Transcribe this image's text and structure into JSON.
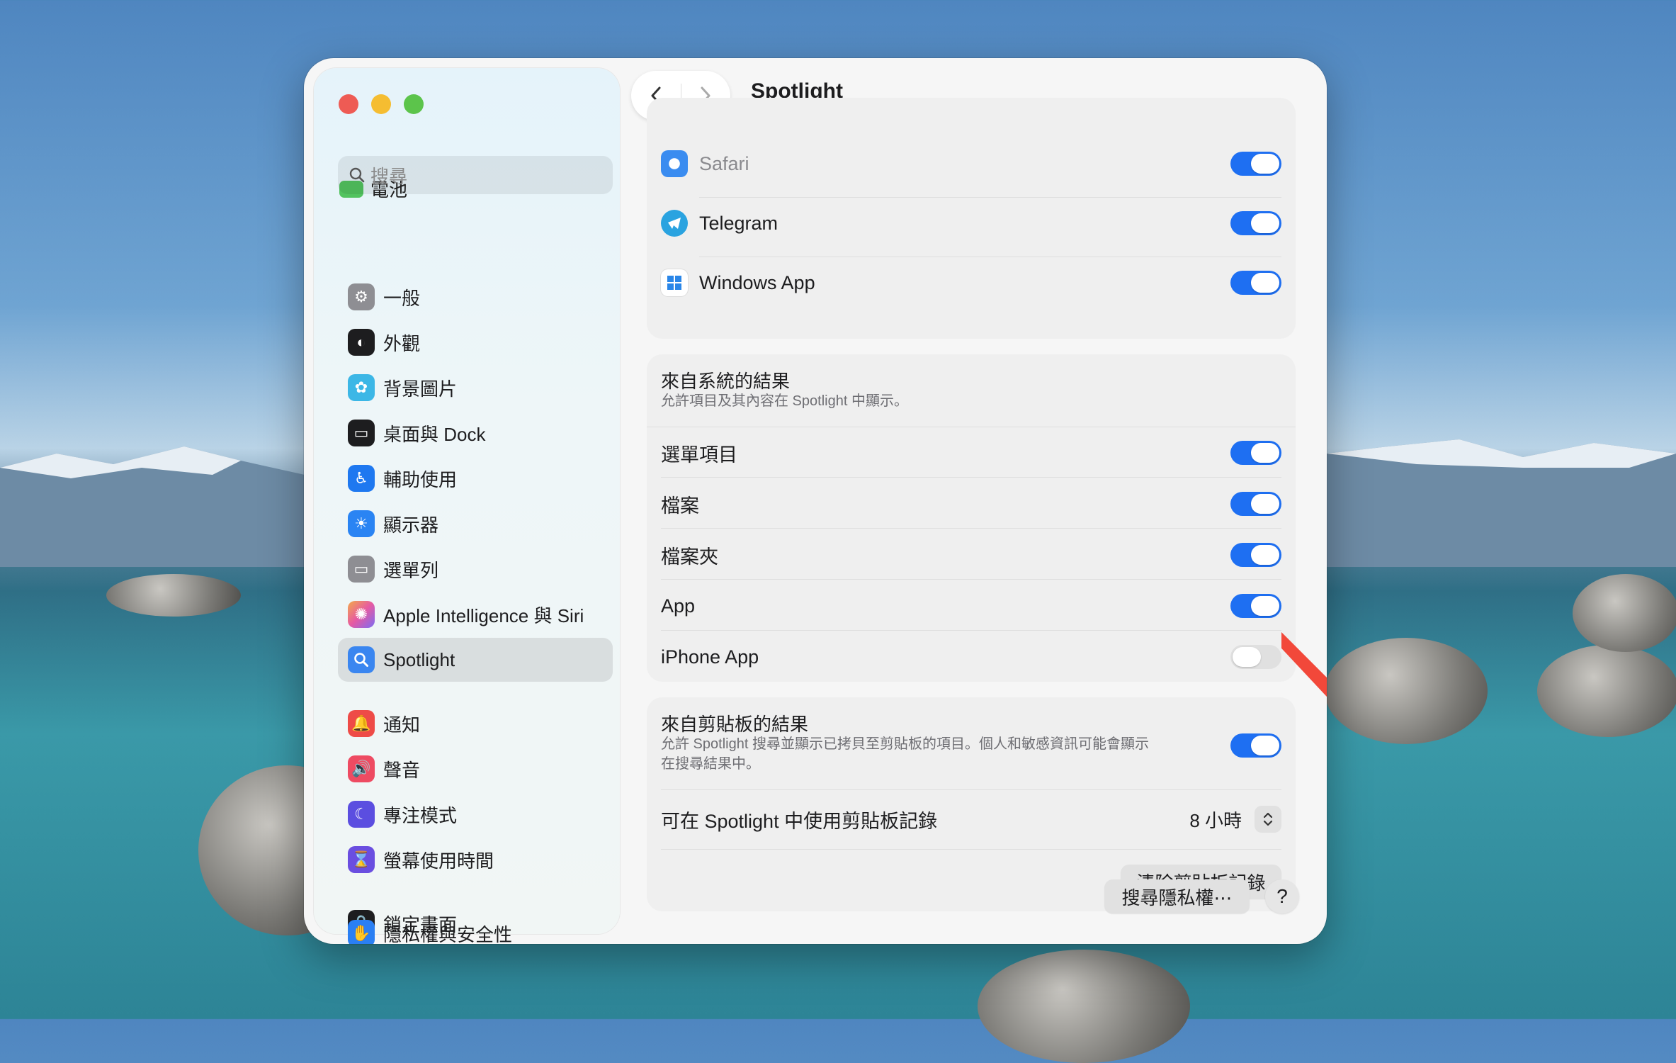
{
  "sidebar": {
    "search_placeholder": "搜尋",
    "ghost_item": "電池",
    "items": [
      {
        "label": "一般",
        "icon": "gear-icon"
      },
      {
        "label": "外觀",
        "icon": "appearance-icon"
      },
      {
        "label": "背景圖片",
        "icon": "wallpaper-icon"
      },
      {
        "label": "桌面與 Dock",
        "icon": "desktop-dock-icon"
      },
      {
        "label": "輔助使用",
        "icon": "accessibility-icon"
      },
      {
        "label": "顯示器",
        "icon": "display-icon"
      },
      {
        "label": "選單列",
        "icon": "menu-bar-icon"
      },
      {
        "label": "Apple Intelligence 與 Siri",
        "icon": "siri-icon"
      },
      {
        "label": "Spotlight",
        "icon": "spotlight-icon",
        "selected": true
      },
      {
        "label": "通知",
        "icon": "notifications-icon"
      },
      {
        "label": "聲音",
        "icon": "sound-icon"
      },
      {
        "label": "專注模式",
        "icon": "focus-icon"
      },
      {
        "label": "螢幕使用時間",
        "icon": "screen-time-icon"
      },
      {
        "label": "鎖定畫面",
        "icon": "lock-screen-icon"
      },
      {
        "label": "隱私權與安全性",
        "icon": "privacy-icon"
      }
    ]
  },
  "toolbar": {
    "title": "Spotlight"
  },
  "apps_card": {
    "rows": [
      {
        "label": "Safari",
        "enabled": true
      },
      {
        "label": "Telegram",
        "enabled": true
      },
      {
        "label": "Windows App",
        "enabled": true
      }
    ]
  },
  "system_card": {
    "title": "來自系統的結果",
    "description": "允許項目及其內容在 Spotlight 中顯示。",
    "rows": [
      {
        "label": "選單項目",
        "enabled": true
      },
      {
        "label": "檔案",
        "enabled": true
      },
      {
        "label": "檔案夾",
        "enabled": true
      },
      {
        "label": "App",
        "enabled": true
      },
      {
        "label": "iPhone App",
        "enabled": false
      }
    ]
  },
  "clipboard_card": {
    "title": "來自剪貼板的結果",
    "description_line1": "允許 Spotlight 搜尋並顯示已拷貝至剪貼板的項目。個人和敏感資訊可能會顯示",
    "description_line2": "在搜尋結果中。",
    "enabled": true,
    "history_label": "可在 Spotlight 中使用剪貼板記錄",
    "history_value": "8 小時",
    "clear_button": "清除剪貼板記錄"
  },
  "footer": {
    "privacy_button": "搜尋隱私權⋯",
    "help_label": "?"
  },
  "colors": {
    "accent": "#1e6ff2",
    "annotation_arrow": "#f2483a"
  }
}
